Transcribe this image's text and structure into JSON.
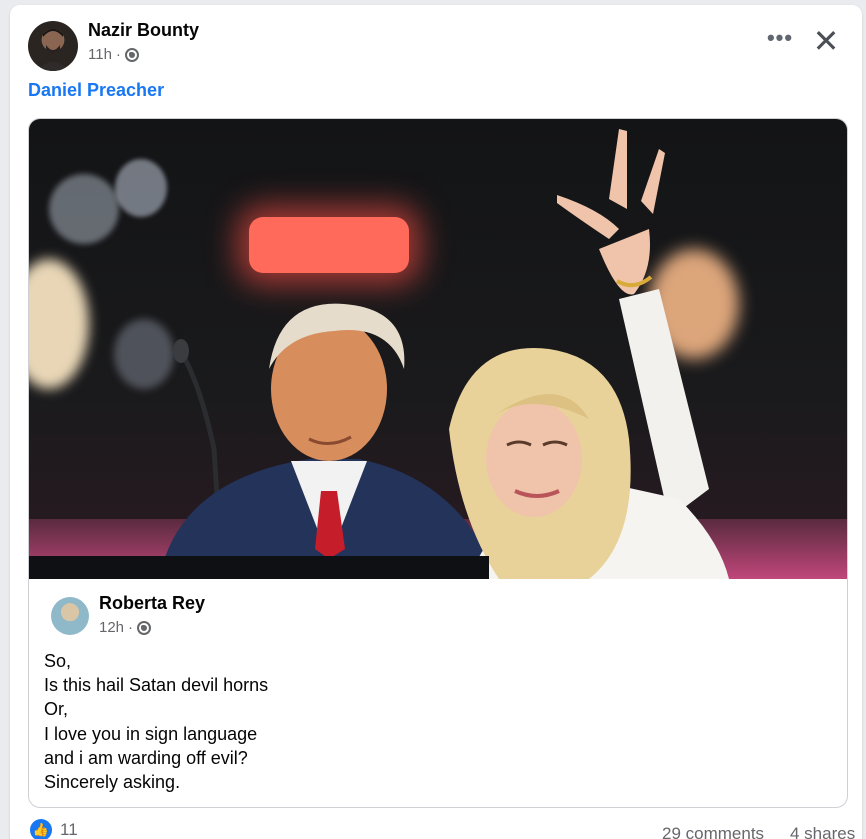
{
  "post": {
    "author": "Nazir Bounty",
    "time": "11h",
    "separator": "·",
    "mention": "Daniel Preacher",
    "more_label": "•••",
    "close_label": "✕"
  },
  "shared_post": {
    "author": "Roberta Rey",
    "time": "12h",
    "separator": "·",
    "lines": [
      "So,",
      "Is this hail Satan devil horns",
      "Or,",
      "I love you in sign language",
      "and i am warding off evil?",
      "Sincerely asking."
    ]
  },
  "engagement": {
    "reactions_count": "11",
    "comments": "29 comments",
    "shares": "4 shares"
  },
  "icons": {
    "privacy": "globe-icon",
    "like": "like-icon",
    "more": "more-icon",
    "close": "close-icon"
  },
  "colors": {
    "link": "#1877f2",
    "secondary_text": "#65676b"
  }
}
